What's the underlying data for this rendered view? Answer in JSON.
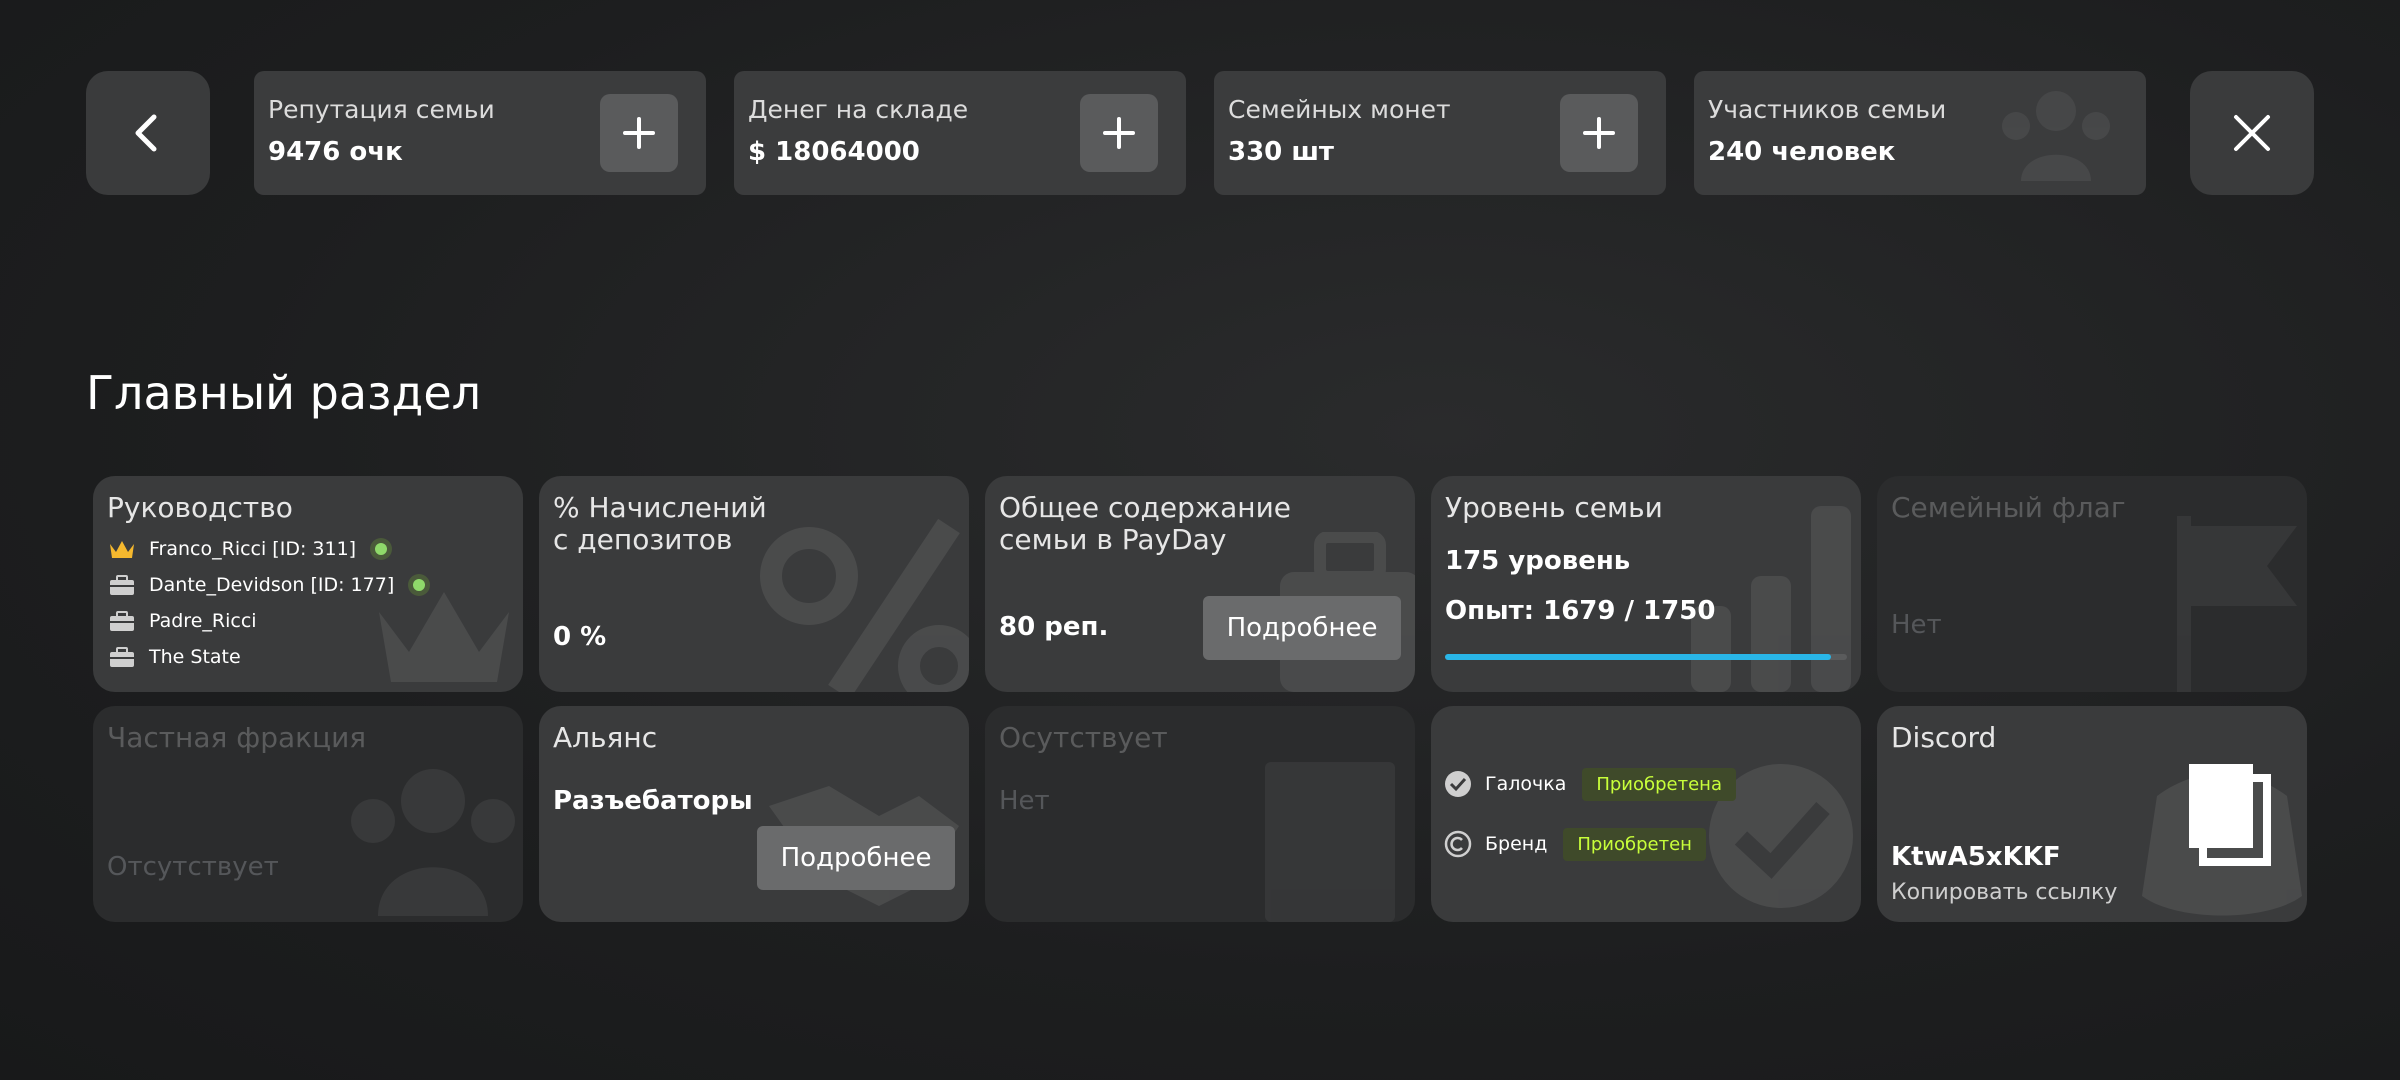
{
  "header": {
    "stats": [
      {
        "label": "Репутация семьи",
        "value": "9476 очк",
        "has_plus": true
      },
      {
        "label": "Денег на складе",
        "value": "$ 18064000",
        "has_plus": true
      },
      {
        "label": "Семейных монет",
        "value": "330 шт",
        "has_plus": true
      },
      {
        "label": "Участников семьи",
        "value": "240 человек",
        "has_plus": false
      }
    ],
    "back_icon": "chevron-left-icon",
    "close_icon": "close-icon"
  },
  "section": {
    "title": "Главный раздел"
  },
  "cards": {
    "leadership": {
      "title": "Руководство",
      "members": [
        {
          "name": "Franco_Ricci [ID: 311]",
          "icon": "crown-icon",
          "online": true
        },
        {
          "name": "Dante_Devidson [ID: 177]",
          "icon": "briefcase-icon",
          "online": true
        },
        {
          "name": "Padre_Ricci",
          "icon": "briefcase-icon",
          "online": false
        },
        {
          "name": "The State",
          "icon": "briefcase-icon",
          "online": false
        }
      ]
    },
    "deposits": {
      "title": "% Начислений\nс депозитов",
      "value": "0 %"
    },
    "payday": {
      "title": "Общее содержание\nсемьи в PayDay",
      "value": "80 реп.",
      "button": "Подробнее"
    },
    "level": {
      "title": "Уровень семьи",
      "level": "175 уровень",
      "exp": "Опыт: 1679 / 1750",
      "progress": 0.9594
    },
    "flag": {
      "title": "Семейный флаг",
      "value": "Нет"
    },
    "faction": {
      "title": "Частная фракция",
      "value": "Отсутствует"
    },
    "alliance": {
      "title": "Альянс",
      "value": "Разъебаторы",
      "button": "Подробнее"
    },
    "absent": {
      "title": "Осутствует",
      "value": "Нет"
    },
    "badges": {
      "items": [
        {
          "label": "Галочка",
          "status": "Приобретена",
          "icon": "verified-icon"
        },
        {
          "label": "Бренд",
          "status": "Приобретен",
          "icon": "copyright-icon"
        }
      ]
    },
    "discord": {
      "title": "Discord",
      "code": "KtwA5xKKF",
      "copy_label": "Копировать ссылку"
    }
  },
  "colors": {
    "accent": "#29b6e8",
    "online": "#8fd96a",
    "badge_text": "#c8ff3a",
    "crown": "#f5b82e"
  }
}
